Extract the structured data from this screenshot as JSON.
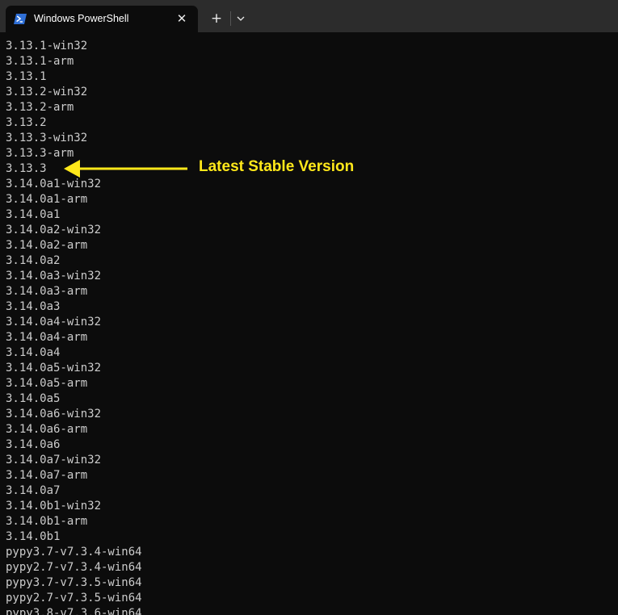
{
  "window": {
    "tab_title": "Windows PowerShell",
    "tab_close_glyph": "✕",
    "new_tab_glyph": "+",
    "tab_icon": "powershell-icon",
    "dropdown_icon": "chevron-down-icon"
  },
  "terminal": {
    "lines": [
      "3.13.1-win32",
      "3.13.1-arm",
      "3.13.1",
      "3.13.2-win32",
      "3.13.2-arm",
      "3.13.2",
      "3.13.3-win32",
      "3.13.3-arm",
      "3.13.3",
      "3.14.0a1-win32",
      "3.14.0a1-arm",
      "3.14.0a1",
      "3.14.0a2-win32",
      "3.14.0a2-arm",
      "3.14.0a2",
      "3.14.0a3-win32",
      "3.14.0a3-arm",
      "3.14.0a3",
      "3.14.0a4-win32",
      "3.14.0a4-arm",
      "3.14.0a4",
      "3.14.0a5-win32",
      "3.14.0a5-arm",
      "3.14.0a5",
      "3.14.0a6-win32",
      "3.14.0a6-arm",
      "3.14.0a6",
      "3.14.0a7-win32",
      "3.14.0a7-arm",
      "3.14.0a7",
      "3.14.0b1-win32",
      "3.14.0b1-arm",
      "3.14.0b1",
      "pypy3.7-v7.3.4-win64",
      "pypy2.7-v7.3.4-win64",
      "pypy3.7-v7.3.5-win64",
      "pypy2.7-v7.3.5-win64",
      "pypy3.8-v7.3.6-win64"
    ]
  },
  "annotation": {
    "label": "Latest Stable Version",
    "color": "#ffe81a"
  },
  "colors": {
    "terminal_background": "#0c0c0c",
    "terminal_text": "#cccccc",
    "titlebar": "#2c2c2c",
    "powershell_icon": "#2f6fd6"
  }
}
